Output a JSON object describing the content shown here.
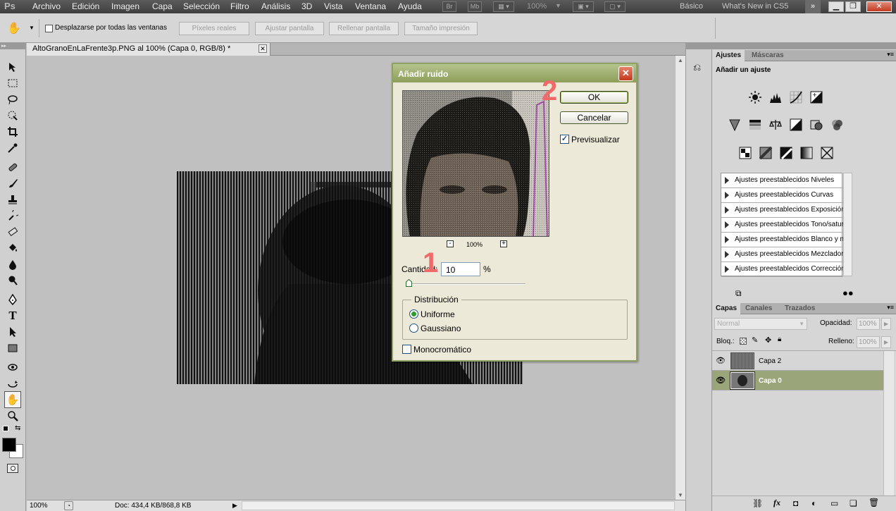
{
  "app": {
    "logo": "Ps",
    "zoom": "100%"
  },
  "menu": [
    "Archivo",
    "Edición",
    "Imagen",
    "Capa",
    "Selección",
    "Filtro",
    "Análisis",
    "3D",
    "Vista",
    "Ventana",
    "Ayuda"
  ],
  "menubar": {
    "br": "Br",
    "mb": "Mb",
    "workspaces": [
      "Básico",
      "What's New in CS5"
    ]
  },
  "options": {
    "scroll_all_label": "Desplazarse por todas las ventanas",
    "buttons": [
      "Píxeles reales",
      "Ajustar pantalla",
      "Rellenar pantalla",
      "Tamaño impresión"
    ]
  },
  "document": {
    "tab_title": "AltoGranoEnLaFrente3p.PNG al 100% (Capa 0, RGB/8) *"
  },
  "status": {
    "zoom": "100%",
    "doc": "Doc: 434,4 KB/868,8 KB"
  },
  "dialog": {
    "title": "Añadir ruido",
    "ok": "OK",
    "cancel": "Cancelar",
    "preview": "Previsualizar",
    "preview_zoom": "100%",
    "amount_label": "Cantidad:",
    "amount_value": "10",
    "amount_unit": "%",
    "amount_fraction": 0.025,
    "distribution_title": "Distribución",
    "uniform": "Uniforme",
    "gaussian": "Gaussiano",
    "monochrome": "Monocromático",
    "annot1": "1",
    "annot2": "2"
  },
  "adjustments": {
    "tabs": [
      "Ajustes",
      "Máscaras"
    ],
    "heading": "Añadir un ajuste",
    "presets": [
      "Ajustes preestablecidos Niveles",
      "Ajustes preestablecidos Curvas",
      "Ajustes preestablecidos Exposición",
      "Ajustes preestablecidos Tono/saturación",
      "Ajustes preestablecidos Blanco y negro",
      "Ajustes preestablecidos Mezclador de canales",
      "Ajustes preestablecidos Corrección selectiva"
    ]
  },
  "layers": {
    "tabs": [
      "Capas",
      "Canales",
      "Trazados"
    ],
    "blend": "Normal",
    "opacity_label": "Opacidad:",
    "opacity": "100%",
    "lock_label": "Bloq.:",
    "fill_label": "Relleno:",
    "fill": "100%",
    "items": [
      "Capa 2",
      "Capa 0"
    ]
  }
}
